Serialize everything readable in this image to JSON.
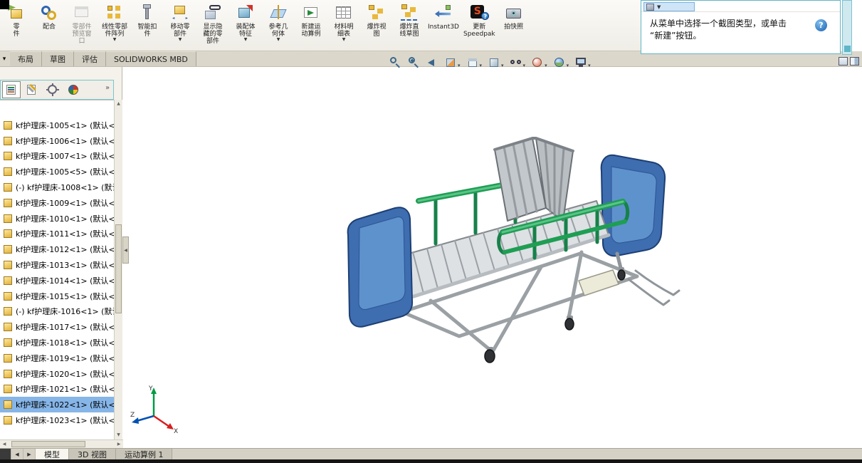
{
  "ribbon": {
    "items": [
      {
        "name": "insert-component",
        "label": "零\n件",
        "icon": "ri-part"
      },
      {
        "name": "mate",
        "label": "配合",
        "icon": "ri-mate"
      },
      {
        "name": "component-preview-window",
        "label": "零部件\n预览窗\n口",
        "icon": "ri-preview",
        "disabled": true
      },
      {
        "name": "linear-component-pattern",
        "label": "线性零部\n件阵列",
        "icon": "ri-pattern",
        "dropdown": true
      },
      {
        "name": "smart-fasteners",
        "label": "智能扣\n件",
        "icon": "ri-fastener"
      },
      {
        "name": "move-component",
        "label": "移动零\n部件",
        "icon": "ri-move",
        "dropdown": true
      },
      {
        "name": "show-hidden-components",
        "label": "显示隐\n藏的零\n部件",
        "icon": "ri-showhidden"
      },
      {
        "name": "assembly-features",
        "label": "装配体\n特征",
        "icon": "ri-asmfeat",
        "dropdown": true
      },
      {
        "name": "reference-geometry",
        "label": "参考几\n何体",
        "icon": "ri-refgeo",
        "dropdown": true
      },
      {
        "name": "new-motion-study",
        "label": "新建运\n动算例",
        "icon": "ri-motion"
      },
      {
        "name": "bill-of-materials",
        "label": "材料明\n细表",
        "icon": "ri-bom",
        "dropdown": true
      },
      {
        "name": "exploded-view",
        "label": "爆炸视\n图",
        "icon": "ri-explode"
      },
      {
        "name": "explode-line-sketch",
        "label": "爆炸直\n线草图",
        "icon": "ri-explodeline"
      },
      {
        "name": "instant3d",
        "label": "Instant3D",
        "icon": "ri-instant3d"
      },
      {
        "name": "update-speedpak",
        "label": "更新\nSpeedpak",
        "icon": "ri-speedpak"
      },
      {
        "name": "take-snapshot",
        "label": "拍快照",
        "icon": "ri-snapshot"
      }
    ]
  },
  "help_panel": {
    "text": "从菜单中选择一个截图类型，或单击\n“新建”按钮。"
  },
  "ribbon_tabs": {
    "items": [
      {
        "name": "tab-layout",
        "label": "布局"
      },
      {
        "name": "tab-sketch",
        "label": "草图"
      },
      {
        "name": "tab-evaluate",
        "label": "评估"
      },
      {
        "name": "tab-solidworks-mbd",
        "label": "SOLIDWORKS MBD"
      }
    ]
  },
  "headsup": {
    "items": [
      {
        "name": "zoom-to-fit",
        "icon": "vi-mag"
      },
      {
        "name": "zoom-to-area",
        "icon": "vi-magp"
      },
      {
        "name": "previous-view",
        "icon": "vi-prev"
      },
      {
        "name": "section-view",
        "icon": "vi-section",
        "dropdown": true
      },
      {
        "name": "view-orientation",
        "icon": "vi-cube",
        "dropdown": true
      },
      {
        "name": "display-style",
        "icon": "vi-cubeshade",
        "dropdown": true
      },
      {
        "name": "hide-show-items",
        "icon": "vi-glasses",
        "dropdown": true
      },
      {
        "name": "edit-appearance",
        "icon": "vi-ball",
        "dropdown": true
      },
      {
        "name": "apply-scene",
        "icon": "vi-scene",
        "dropdown": true
      },
      {
        "name": "view-settings",
        "icon": "vi-monitor",
        "dropdown": true
      }
    ]
  },
  "panel_toolbar": {
    "overflow": "»",
    "items": [
      {
        "name": "featuremanager-tab",
        "icon": "pi-feattree",
        "active": true
      },
      {
        "name": "propertymanager-tab",
        "icon": "pi-propmgr"
      },
      {
        "name": "configurationmanager-tab",
        "icon": "pi-configmgr"
      },
      {
        "name": "dimxpertmanager-tab",
        "icon": "pi-dimxpert"
      }
    ]
  },
  "tree": {
    "items": [
      {
        "label": "kf护理床-1005<1> (默认<"
      },
      {
        "label": "kf护理床-1006<1> (默认<"
      },
      {
        "label": "kf护理床-1007<1> (默认<"
      },
      {
        "label": "kf护理床-1005<5> (默认<"
      },
      {
        "label": "(-) kf护理床-1008<1> (默认"
      },
      {
        "label": "kf护理床-1009<1> (默认<"
      },
      {
        "label": "kf护理床-1010<1> (默认<"
      },
      {
        "label": "kf护理床-1011<1> (默认<"
      },
      {
        "label": "kf护理床-1012<1> (默认<"
      },
      {
        "label": "kf护理床-1013<1> (默认<"
      },
      {
        "label": "kf护理床-1014<1> (默认<"
      },
      {
        "label": "kf护理床-1015<1> (默认<"
      },
      {
        "label": "(-) kf护理床-1016<1> (默认"
      },
      {
        "label": "kf护理床-1017<1> (默认<"
      },
      {
        "label": "kf护理床-1018<1> (默认<"
      },
      {
        "label": "kf护理床-1019<1> (默认<"
      },
      {
        "label": "kf护理床-1020<1> (默认<"
      },
      {
        "label": "kf护理床-1021<1> (默认<"
      },
      {
        "label": "kf护理床-1022<1> (默认<",
        "selected": true
      },
      {
        "label": "kf护理床-1023<1> (默认<"
      }
    ]
  },
  "bottom_tabs": {
    "items": [
      {
        "name": "tab-model",
        "label": "模型",
        "active": true
      },
      {
        "name": "tab-3d-views",
        "label": "3D 视图"
      },
      {
        "name": "tab-motion-study-1",
        "label": "运动算例 1"
      }
    ]
  },
  "triad": {
    "x": "X",
    "y": "Y",
    "z": "Z"
  },
  "colors": {
    "accent_teal": "#5fb6c6",
    "selection_blue": "#86b5e8",
    "rail_green": "#1f9e54",
    "bed_blue": "#3e6db0"
  }
}
